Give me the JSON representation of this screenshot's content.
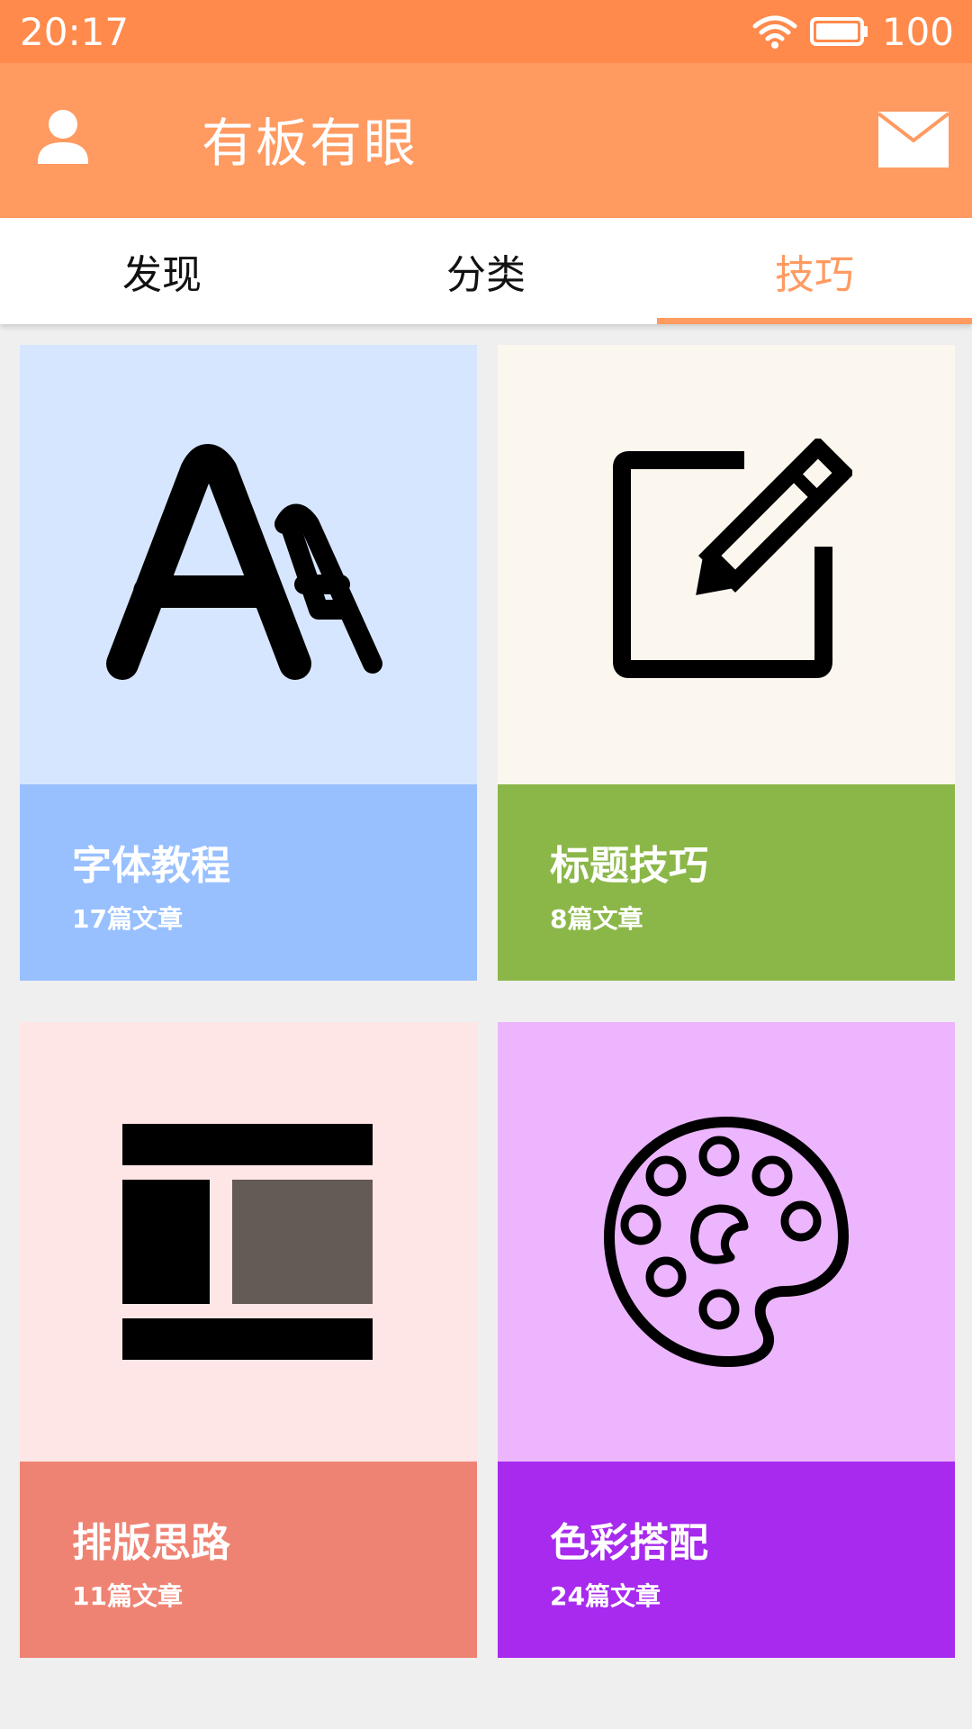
{
  "status": {
    "time": "20:17",
    "battery": "100"
  },
  "app": {
    "title": "有板有眼"
  },
  "tabs": [
    {
      "label": "发现"
    },
    {
      "label": "分类"
    },
    {
      "label": "技巧"
    }
  ],
  "cards": [
    {
      "title": "字体教程",
      "count": "17篇文章",
      "icon": "font-icon",
      "art_color": "#d6e6fe",
      "info_color": "#98c0fe"
    },
    {
      "title": "标题技巧",
      "count": "8篇文章",
      "icon": "edit-icon",
      "art_color": "#fbf7ee",
      "info_color": "#8bb749"
    },
    {
      "title": "排版思路",
      "count": "11篇文章",
      "icon": "layout-icon",
      "art_color": "#fee6e6",
      "info_color": "#ef8373"
    },
    {
      "title": "色彩搭配",
      "count": "24篇文章",
      "icon": "palette-icon",
      "art_color": "#ecb5fe",
      "info_color": "#a72aee"
    }
  ],
  "colors": {
    "status_bar": "#ff8a4c",
    "app_bar": "#ff9a61",
    "accent": "#ff9a61",
    "background": "#efefef"
  }
}
